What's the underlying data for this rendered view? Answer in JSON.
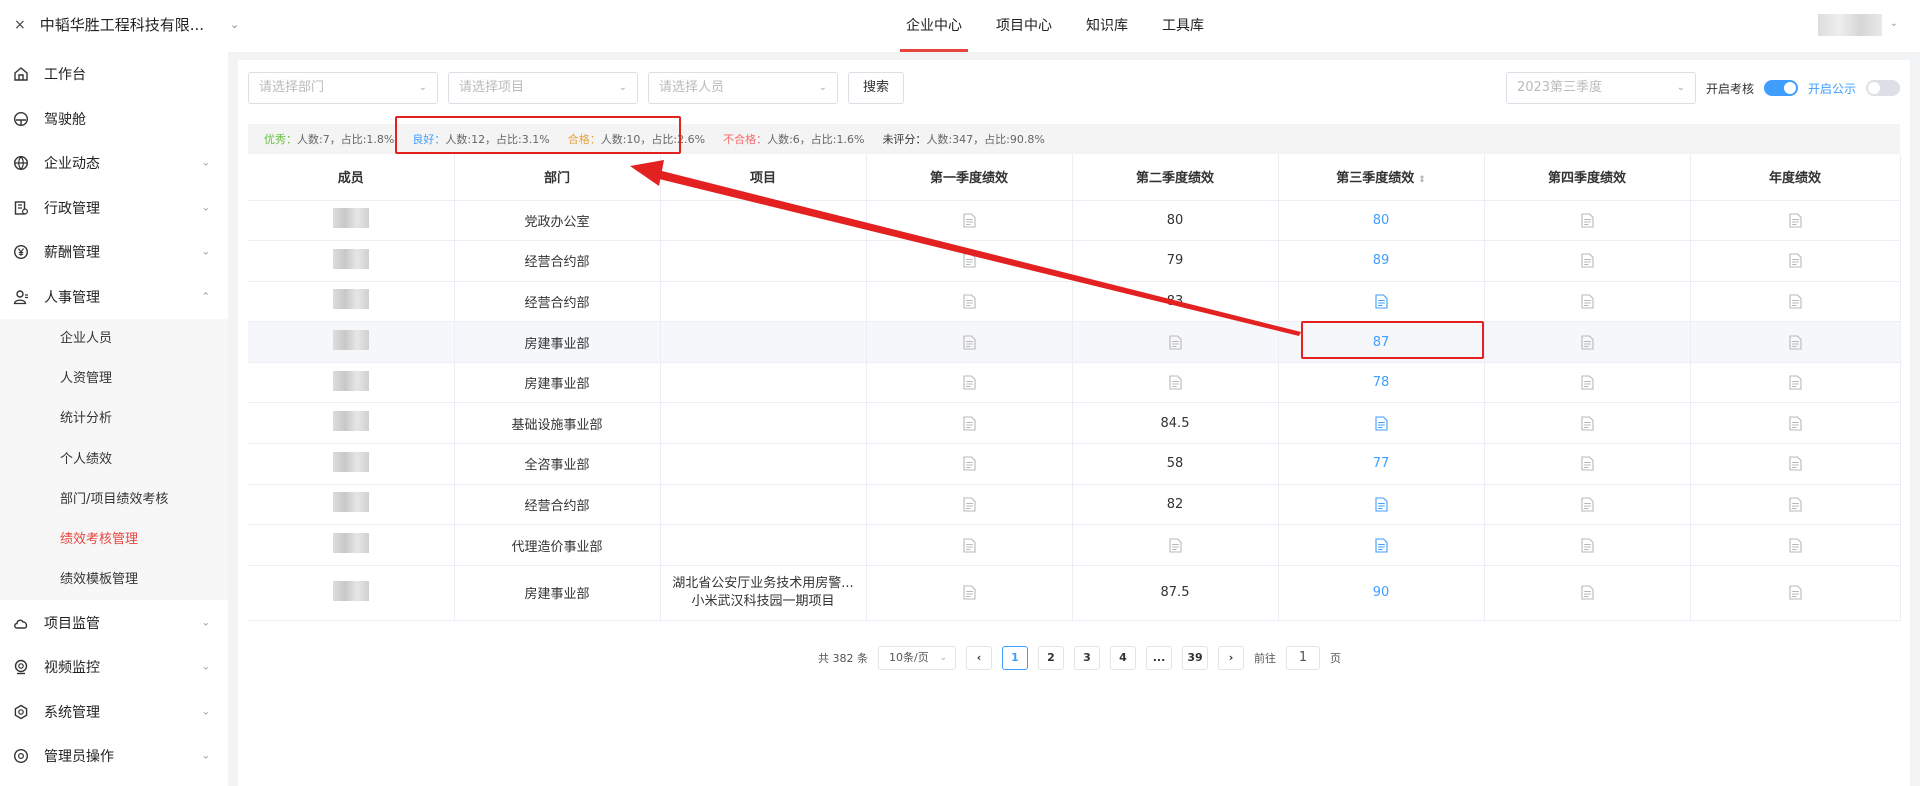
{
  "header": {
    "close_glyph": "×",
    "company": "中韬华胜工程科技有限...",
    "tabs": [
      {
        "label": "企业中心",
        "active": true
      },
      {
        "label": "项目中心"
      },
      {
        "label": "知识库"
      },
      {
        "label": "工具库"
      }
    ]
  },
  "sidebar": {
    "items": [
      {
        "label": "工作台",
        "icon": "home-icon"
      },
      {
        "label": "驾驶舱",
        "icon": "dashboard-icon"
      },
      {
        "label": "企业动态",
        "icon": "globe-icon"
      },
      {
        "label": "行政管理",
        "icon": "admin-icon"
      },
      {
        "label": "薪酬管理",
        "icon": "salary-icon"
      },
      {
        "label": "人事管理",
        "icon": "user-icon"
      }
    ],
    "sub_items": [
      {
        "label": "企业人员"
      },
      {
        "label": "人资管理"
      },
      {
        "label": "统计分析"
      },
      {
        "label": "个人绩效"
      },
      {
        "label": "部门/项目绩效考核"
      },
      {
        "label": "绩效考核管理",
        "active": true
      },
      {
        "label": "绩效模板管理"
      }
    ],
    "items_after": [
      {
        "label": "项目监管",
        "icon": "cloud-icon"
      },
      {
        "label": "视频监控",
        "icon": "camera-icon"
      },
      {
        "label": "系统管理",
        "icon": "settings-icon"
      },
      {
        "label": "管理员操作",
        "icon": "gear-icon"
      }
    ]
  },
  "filters": {
    "department_placeholder": "请选择部门",
    "project_placeholder": "请选择项目",
    "person_placeholder": "请选择人员",
    "search_label": "搜索",
    "quarter_placeholder": "2023第三季度",
    "enable_review_label": "开启考核",
    "enable_public_label": "开启公示"
  },
  "stats": {
    "excellent_label": "优秀：",
    "excellent_text": "人数:7，占比:1.8%",
    "good_label": "良好：",
    "good_text": "人数:12，占比:3.1%",
    "pass_label": "合格：",
    "pass_text": "人数:10，占比:2.6%",
    "fail_label": "不合格：",
    "fail_text": "人数:6，占比:1.6%",
    "unrated_label": "未评分：",
    "unrated_text": "人数:347，占比:90.8%"
  },
  "table": {
    "headers": [
      "成员",
      "部门",
      "项目",
      "第一季度绩效",
      "第二季度绩效",
      "第三季度绩效",
      "第四季度绩效",
      "年度绩效"
    ],
    "rows": [
      {
        "dept": "党政办公室",
        "project": "",
        "q2": "80",
        "q3": "80"
      },
      {
        "dept": "经营合约部",
        "project": "",
        "q2": "79",
        "q3": "89"
      },
      {
        "dept": "经营合约部",
        "project": "",
        "q2": "83",
        "q3": ""
      },
      {
        "dept": "房建事业部",
        "project": "",
        "q2": "",
        "q3": "87"
      },
      {
        "dept": "房建事业部",
        "project": "",
        "q2": "",
        "q3": "78"
      },
      {
        "dept": "基础设施事业部",
        "project": "",
        "q2": "84.5",
        "q3": ""
      },
      {
        "dept": "全咨事业部",
        "project": "",
        "q2": "58",
        "q3": "77"
      },
      {
        "dept": "经营合约部",
        "project": "",
        "q2": "82",
        "q3": ""
      },
      {
        "dept": "代理造价事业部",
        "project": "",
        "q2": "",
        "q3": ""
      },
      {
        "dept": "房建事业部",
        "project": "湖北省公安厅业务技术用房警...小米武汉科技园一期项目",
        "project_line1": "湖北省公安厅业务技术用房警...",
        "project_line2": "小米武汉科技园一期项目",
        "q2": "87.5",
        "q3": "90"
      }
    ]
  },
  "pagination": {
    "total_text": "共 382 条",
    "page_size": "10条/页",
    "pages": [
      "1",
      "2",
      "3",
      "4",
      "...",
      "39"
    ],
    "goto_label": "前往",
    "goto_value": "1",
    "page_suffix": "页"
  },
  "colors": {
    "accent_red": "#e8453c",
    "link_blue": "#409eff",
    "annotation_red": "#e32121"
  }
}
